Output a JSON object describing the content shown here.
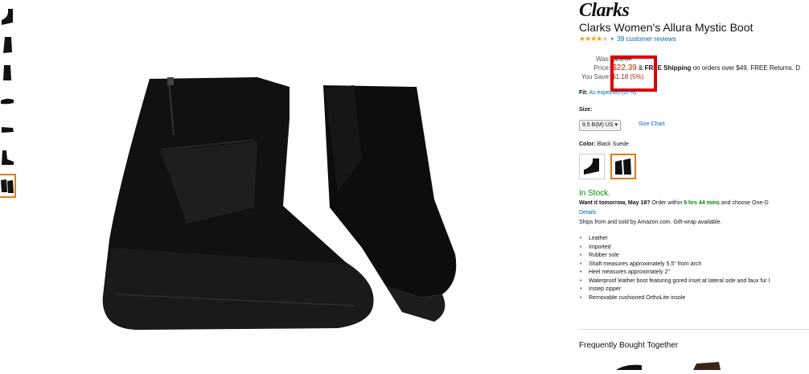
{
  "brand": "Clarks",
  "product_title": "Clarks Women's Allura Mystic Boot",
  "rating": {
    "stars": 4,
    "reviews_link": "39 customer reviews",
    "dropdown_arrow": "▾"
  },
  "pricing": {
    "was_label": "Was:",
    "was_value": "$23.57",
    "price_label": "Price:",
    "price_value": "$22.39",
    "shipping_prefix": " & ",
    "shipping_bold": "FREE Shipping",
    "shipping_suffix": " on orders over $49. FREE Returns. D",
    "save_label": "You Save:",
    "save_value": "$1.18 (5%)"
  },
  "fit": {
    "label": "Fit:",
    "value": "As expected (67%)"
  },
  "size": {
    "label": "Size:",
    "selected": "9.5 B(M) US",
    "chart_link": "Size Chart"
  },
  "color": {
    "label": "Color:",
    "value": "Black Suede"
  },
  "availability": {
    "status": "In Stock.",
    "delivery_bold": "Want it tomorrow, May 18?",
    "delivery_mid": " Order within ",
    "delivery_time": "9 hrs 44 mins",
    "delivery_end": " and choose One-D",
    "details_link": "Details",
    "ships_text": "Ships from and sold by Amazon.com. Gift-wrap available."
  },
  "features": [
    "Leather",
    "Imported",
    "Rubber sole",
    "Shaft measures approximately 5.5\" from arch",
    "Heel measures approximately 2\"",
    "Waterproof leather boot featuring gored inset at lateral side and faux fur l",
    "Instep zipper",
    "Removable cushioned OrthoLite insole"
  ],
  "frequently_bought": "Frequently Bought Together",
  "colors": {
    "accent": "#e47911",
    "price_red": "#b12704",
    "link": "#0066c0",
    "highlight": "#e00000",
    "stock_green": "#008a00"
  }
}
